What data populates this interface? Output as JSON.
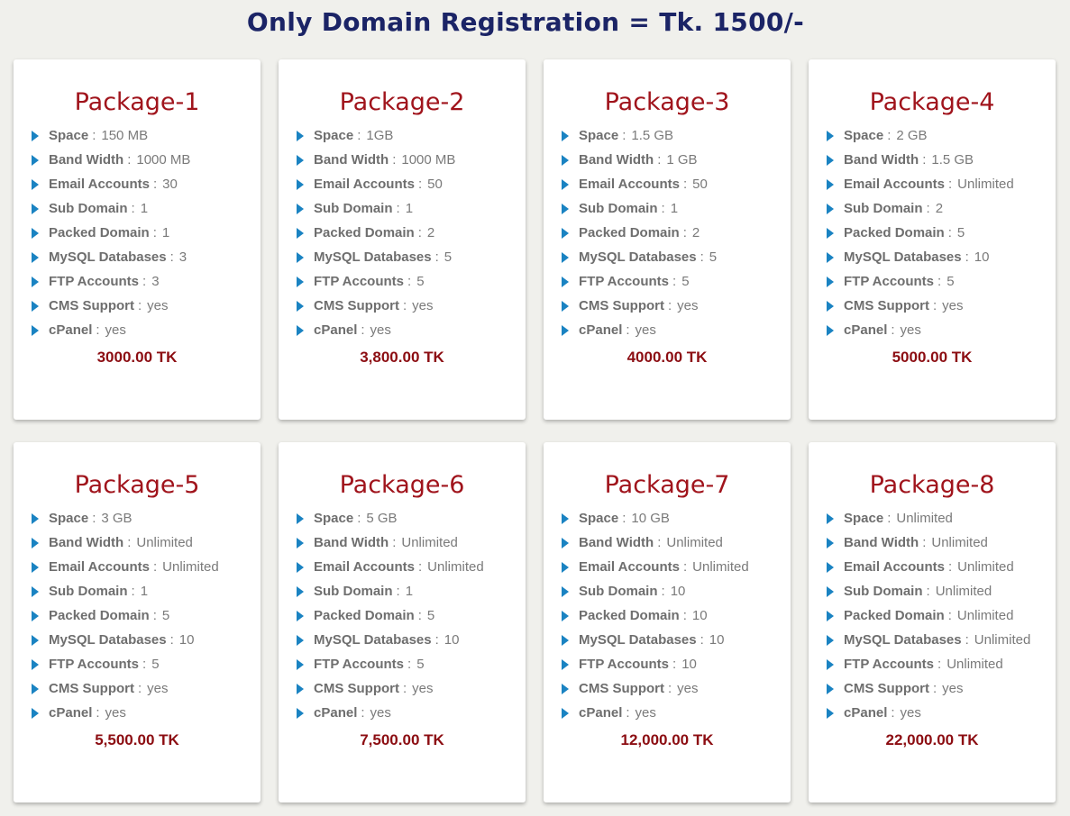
{
  "header": {
    "title": "Only Domain Registration = Tk. 1500/-"
  },
  "feature_labels": [
    "Space",
    "Band Width",
    "Email Accounts",
    "Sub Domain",
    "Packed Domain",
    "MySQL Databases",
    "FTP Accounts",
    "CMS Support",
    "cPanel"
  ],
  "feature_separator": ":",
  "icons": {
    "bullet": "triangle-right-icon"
  },
  "colors": {
    "title": "#1b2466",
    "package_name": "#a0141c",
    "price": "#8c0d12",
    "bullet": "#1a83c2"
  },
  "packages": [
    {
      "name": "Package-1",
      "values": [
        "150 MB",
        "1000 MB",
        "30",
        "1",
        "1",
        "3",
        "3",
        "yes",
        "yes"
      ],
      "price": "3000.00 TK"
    },
    {
      "name": "Package-2",
      "values": [
        "1GB",
        "1000 MB",
        "50",
        "1",
        "2",
        "5",
        "5",
        "yes",
        "yes"
      ],
      "price": "3,800.00 TK"
    },
    {
      "name": "Package-3",
      "values": [
        "1.5 GB",
        "1 GB",
        "50",
        "1",
        "2",
        "5",
        "5",
        "yes",
        "yes"
      ],
      "price": "4000.00 TK"
    },
    {
      "name": "Package-4",
      "values": [
        "2 GB",
        "1.5 GB",
        "Unlimited",
        "2",
        "5",
        "10",
        "5",
        "yes",
        "yes"
      ],
      "price": "5000.00 TK"
    },
    {
      "name": "Package-5",
      "values": [
        "3 GB",
        "Unlimited",
        "Unlimited",
        "1",
        "5",
        "10",
        "5",
        "yes",
        "yes"
      ],
      "price": "5,500.00 TK"
    },
    {
      "name": "Package-6",
      "values": [
        "5 GB",
        "Unlimited",
        "Unlimited",
        "1",
        "5",
        "10",
        "5",
        "yes",
        "yes"
      ],
      "price": "7,500.00 TK"
    },
    {
      "name": "Package-7",
      "values": [
        "10 GB",
        "Unlimited",
        "Unlimited",
        "10",
        "10",
        "10",
        "10",
        "yes",
        "yes"
      ],
      "price": "12,000.00 TK"
    },
    {
      "name": "Package-8",
      "values": [
        "Unlimited",
        "Unlimited",
        "Unlimited",
        "Unlimited",
        "Unlimited",
        "Unlimited",
        "Unlimited",
        "yes",
        "yes"
      ],
      "price": "22,000.00 TK"
    }
  ]
}
